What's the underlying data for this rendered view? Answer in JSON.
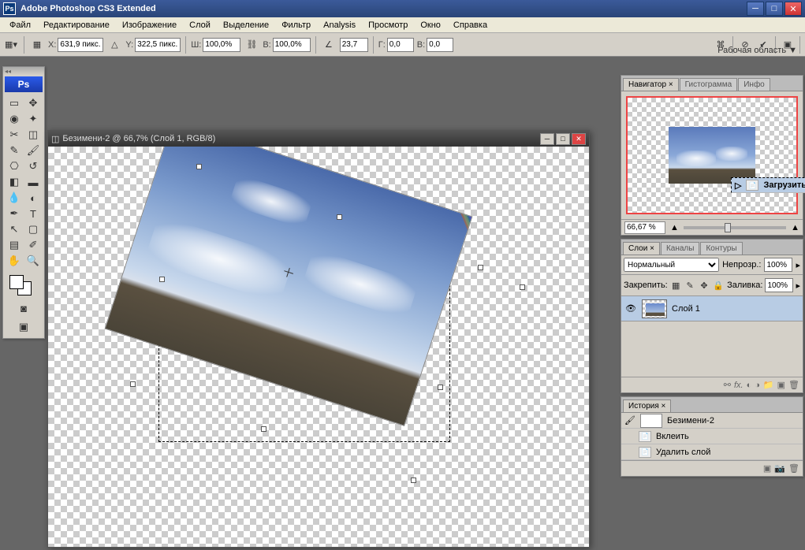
{
  "titlebar": {
    "app_name": "Adobe Photoshop CS3 Extended"
  },
  "menu": [
    "Файл",
    "Редактирование",
    "Изображение",
    "Слой",
    "Выделение",
    "Фильтр",
    "Analysis",
    "Просмотр",
    "Окно",
    "Справка"
  ],
  "options": {
    "x_label": "X:",
    "x_val": "631,9 пикс.",
    "y_label": "Y:",
    "y_val": "322,5 пикс.",
    "w_label": "Ш:",
    "w_val": "100,0%",
    "h_label": "В:",
    "h_val": "100,0%",
    "angle_val": "23,7",
    "sh_label": "Г:",
    "sh_val": "0,0",
    "sv_label": "В:",
    "sv_val": "0,0",
    "workspace": "Рабочая область ▼"
  },
  "doc": {
    "title": "Безимени-2 @ 66,7% (Слой 1, RGB/8)"
  },
  "navigator": {
    "tabs": [
      "Навигатор ×",
      "Гистограмма",
      "Инфо"
    ],
    "zoom": "66,67 %"
  },
  "layers_panel": {
    "tabs": [
      "Слои ×",
      "Каналы",
      "Контуры"
    ],
    "blend": "Нормальный",
    "opacity_label": "Непрозр.:",
    "opacity_val": "100%",
    "lock_label": "Закрепить:",
    "fill_label": "Заливка:",
    "fill_val": "100%",
    "layer1": "Слой 1"
  },
  "history": {
    "tab": "История ×",
    "doc_name": "Безимени-2",
    "items": [
      "Вклеить",
      "Удалить слой",
      "Загрузить выделенную об..."
    ]
  }
}
